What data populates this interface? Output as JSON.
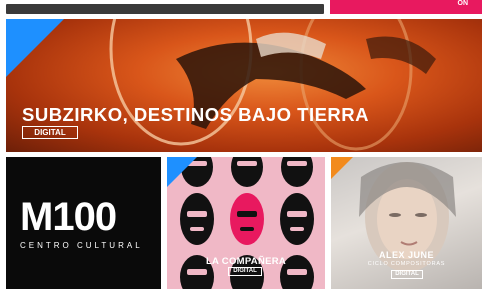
{
  "header": {
    "cta_label": "ON"
  },
  "hero": {
    "title": "SUBZIRKO, DESTINOS BAJO TIERRA",
    "badge": "DIGITAL"
  },
  "cards": {
    "m100": {
      "logo": "M100",
      "subtitle": "CENTRO CULTURAL"
    },
    "compania": {
      "title": "LA COMPAÑERA",
      "badge": "DIGITAL"
    },
    "alex": {
      "title": "ALEX JUNE",
      "subtitle": "CICLO COMPOSITORAS",
      "badge": "DIGITAL"
    }
  },
  "colors": {
    "accent_pink": "#e8195f",
    "accent_blue": "#1e90ff",
    "accent_orange": "#f28a1c"
  }
}
